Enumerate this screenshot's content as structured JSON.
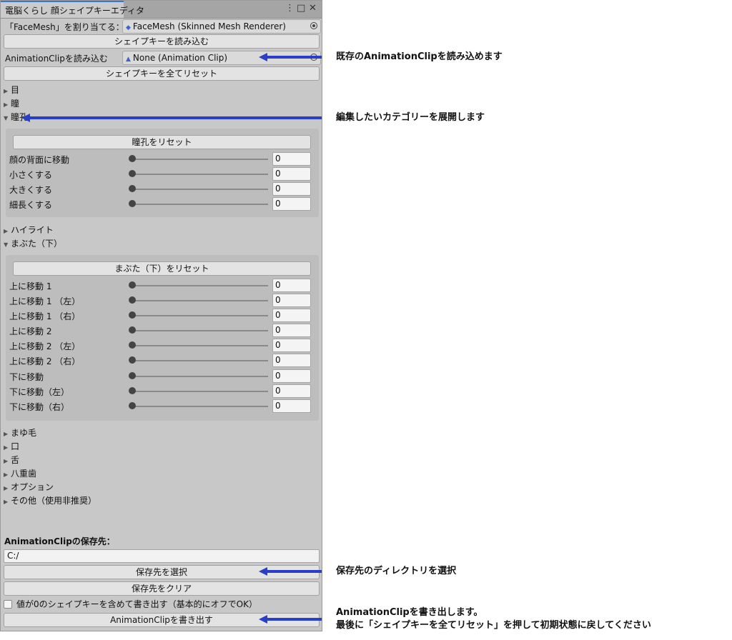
{
  "window": {
    "tab_title": "電脳くらし 顔シェイプキーエディタ",
    "controls": [
      "⋮",
      "□",
      "✕"
    ]
  },
  "assign": {
    "label": "「FaceMesh」を割り当てる：",
    "value": "FaceMesh (Skinned Mesh Renderer)"
  },
  "load_shapekeys_label": "シェイプキーを読み込む",
  "anim_clip": {
    "label": "AnimationClipを読み込む",
    "value": "None (Animation Clip)"
  },
  "reset_all_label": "シェイプキーを全てリセット",
  "categories_top": [
    "目",
    "瞳"
  ],
  "pupil": {
    "title": "瞳孔",
    "reset_label": "瞳孔をリセット",
    "sliders": [
      {
        "label": "顔の背面に移動",
        "value": "0"
      },
      {
        "label": "小さくする",
        "value": "0"
      },
      {
        "label": "大きくする",
        "value": "0"
      },
      {
        "label": "細長くする",
        "value": "0"
      }
    ]
  },
  "highlight_label": "ハイライト",
  "lower_lid": {
    "title": "まぶた（下）",
    "reset_label": "まぶた（下）をリセット",
    "sliders": [
      {
        "label": "上に移動 1",
        "value": "0"
      },
      {
        "label": "上に移動 1 （左）",
        "value": "0"
      },
      {
        "label": "上に移動 1 （右）",
        "value": "0"
      },
      {
        "label": "上に移動 2",
        "value": "0"
      },
      {
        "label": "上に移動 2 （左）",
        "value": "0"
      },
      {
        "label": "上に移動 2 （右）",
        "value": "0"
      },
      {
        "label": "下に移動",
        "value": "0"
      },
      {
        "label": "下に移動（左）",
        "value": "0"
      },
      {
        "label": "下に移動（右）",
        "value": "0"
      }
    ]
  },
  "categories_bottom": [
    "まゆ毛",
    "口",
    "舌",
    "八重歯",
    "オプション",
    "その他（使用非推奨）"
  ],
  "save": {
    "heading": "AnimationClipの保存先：",
    "path": "C:/",
    "select_label": "保存先を選択",
    "clear_label": "保存先をクリア",
    "checkbox_label": "値が0のシェイプキーを含めて書き出す（基本的にオフでOK）",
    "export_label": "AnimationClipを書き出す"
  },
  "annotations": {
    "anim_clip": "既存のAnimationClipを読み込めます",
    "category": "編集したいカテゴリーを展開します",
    "save_dir": "保存先のディレクトリを選択",
    "export_line1": "AnimationClipを書き出します。",
    "export_line2": "最後に「シェイプキーを全てリセット」を押して初期状態に戻してください"
  },
  "colors": {
    "arrow": "#2a3fc9",
    "tab_accent": "#3a72d8",
    "panel_bg": "#c8c8c8"
  }
}
